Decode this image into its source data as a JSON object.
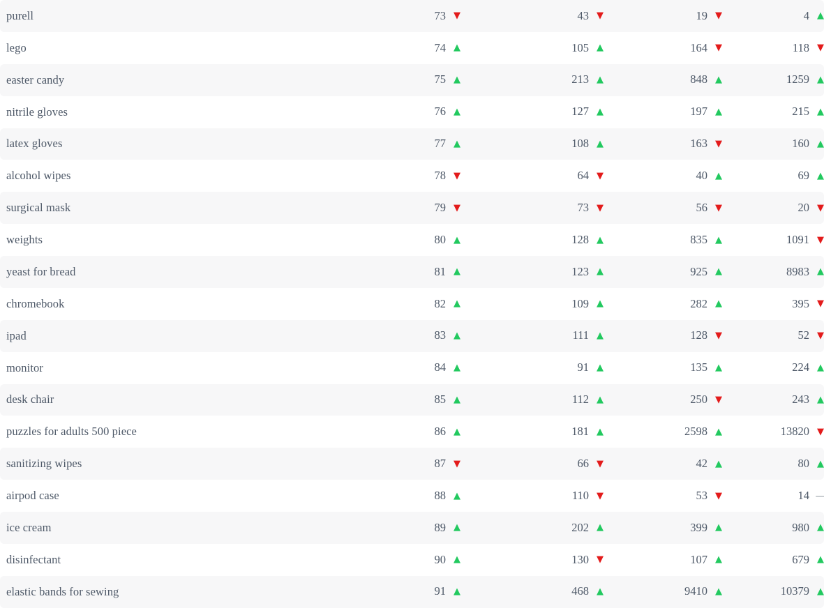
{
  "table": {
    "row_count": 19,
    "column_count": 5,
    "colors": {
      "up_arrow": "#22c95f",
      "down_arrow": "#e31b1b",
      "flat_dash": "#9aa0a8",
      "text": "#4e5968",
      "row_shaded_bg": "#f7f7f8",
      "row_plain_bg": "#ffffff"
    },
    "icons": {
      "up": "▲",
      "down": "▼",
      "flat": "—"
    },
    "rows": [
      {
        "term": "purell",
        "shaded": true,
        "values": [
          "73",
          "43",
          "19",
          "4"
        ],
        "trends": [
          "down",
          "down",
          "down",
          "up"
        ]
      },
      {
        "term": "lego",
        "shaded": false,
        "values": [
          "74",
          "105",
          "164",
          "118"
        ],
        "trends": [
          "up",
          "up",
          "down",
          "down"
        ]
      },
      {
        "term": "easter candy",
        "shaded": true,
        "values": [
          "75",
          "213",
          "848",
          "1259"
        ],
        "trends": [
          "up",
          "up",
          "up",
          "up"
        ]
      },
      {
        "term": "nitrile gloves",
        "shaded": false,
        "values": [
          "76",
          "127",
          "197",
          "215"
        ],
        "trends": [
          "up",
          "up",
          "up",
          "up"
        ]
      },
      {
        "term": "latex gloves",
        "shaded": true,
        "values": [
          "77",
          "108",
          "163",
          "160"
        ],
        "trends": [
          "up",
          "up",
          "down",
          "up"
        ]
      },
      {
        "term": "alcohol wipes",
        "shaded": false,
        "values": [
          "78",
          "64",
          "40",
          "69"
        ],
        "trends": [
          "down",
          "down",
          "up",
          "up"
        ]
      },
      {
        "term": "surgical mask",
        "shaded": true,
        "values": [
          "79",
          "73",
          "56",
          "20"
        ],
        "trends": [
          "down",
          "down",
          "down",
          "down"
        ]
      },
      {
        "term": "weights",
        "shaded": false,
        "values": [
          "80",
          "128",
          "835",
          "1091"
        ],
        "trends": [
          "up",
          "up",
          "up",
          "down"
        ]
      },
      {
        "term": "yeast for bread",
        "shaded": true,
        "values": [
          "81",
          "123",
          "925",
          "8983"
        ],
        "trends": [
          "up",
          "up",
          "up",
          "up"
        ]
      },
      {
        "term": "chromebook",
        "shaded": false,
        "values": [
          "82",
          "109",
          "282",
          "395"
        ],
        "trends": [
          "up",
          "up",
          "up",
          "down"
        ]
      },
      {
        "term": "ipad",
        "shaded": true,
        "values": [
          "83",
          "111",
          "128",
          "52"
        ],
        "trends": [
          "up",
          "up",
          "down",
          "down"
        ]
      },
      {
        "term": "monitor",
        "shaded": false,
        "values": [
          "84",
          "91",
          "135",
          "224"
        ],
        "trends": [
          "up",
          "up",
          "up",
          "up"
        ]
      },
      {
        "term": "desk chair",
        "shaded": true,
        "values": [
          "85",
          "112",
          "250",
          "243"
        ],
        "trends": [
          "up",
          "up",
          "down",
          "up"
        ]
      },
      {
        "term": "puzzles for adults 500 piece",
        "shaded": false,
        "values": [
          "86",
          "181",
          "2598",
          "13820"
        ],
        "trends": [
          "up",
          "up",
          "up",
          "down"
        ]
      },
      {
        "term": "sanitizing wipes",
        "shaded": true,
        "values": [
          "87",
          "66",
          "42",
          "80"
        ],
        "trends": [
          "down",
          "down",
          "up",
          "up"
        ]
      },
      {
        "term": "airpod case",
        "shaded": false,
        "values": [
          "88",
          "110",
          "53",
          "14"
        ],
        "trends": [
          "up",
          "down",
          "down",
          "flat"
        ]
      },
      {
        "term": "ice cream",
        "shaded": true,
        "values": [
          "89",
          "202",
          "399",
          "980"
        ],
        "trends": [
          "up",
          "up",
          "up",
          "up"
        ]
      },
      {
        "term": "disinfectant",
        "shaded": false,
        "values": [
          "90",
          "130",
          "107",
          "679"
        ],
        "trends": [
          "up",
          "down",
          "up",
          "up"
        ]
      },
      {
        "term": "elastic bands for sewing",
        "shaded": true,
        "values": [
          "91",
          "468",
          "9410",
          "10379"
        ],
        "trends": [
          "up",
          "up",
          "up",
          "up"
        ]
      }
    ]
  }
}
